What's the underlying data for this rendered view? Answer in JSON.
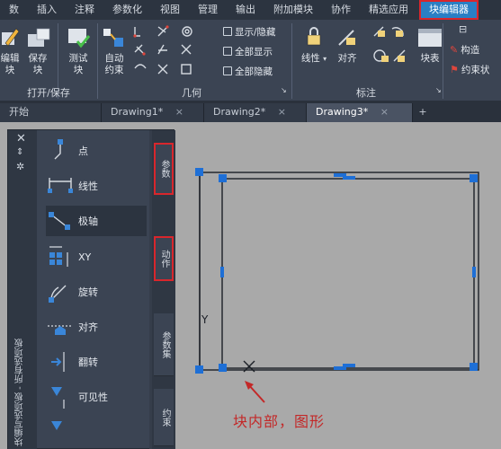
{
  "menubar": {
    "items": [
      "数",
      "插入",
      "注释",
      "参数化",
      "视图",
      "管理",
      "输出",
      "附加模块",
      "协作",
      "精选应用"
    ],
    "active_item": "块编辑器"
  },
  "ribbon": {
    "open_save": {
      "edit_label": "编辑\n块",
      "save_label": "保存\n块",
      "test_label": "测试\n块",
      "group_label": "打开/保存"
    },
    "geometry": {
      "auto_constrain_label": "自动\n约束",
      "show_hide_label": "显示/隐藏",
      "show_all_label": "全部显示",
      "hide_all_label": "全部隐藏",
      "group_label": "几何"
    },
    "dimensional": {
      "linear_label": "线性",
      "align_label": "对齐",
      "group_label": "标注"
    },
    "manage": {
      "block_table_label": "块表",
      "construct_label": "构造",
      "constraint_status_label": "约束状"
    }
  },
  "tabs": {
    "start": "开始",
    "docs": [
      "Drawing1*",
      "Drawing2*",
      "Drawing3*"
    ],
    "active_index": 2
  },
  "palette": {
    "title": "块编写选项板 - 所有选项板",
    "items": [
      "点",
      "线性",
      "极轴",
      "XY",
      "旋转",
      "对齐",
      "翻转",
      "可见性"
    ],
    "selected_index": 2,
    "side_tabs": [
      "参数",
      "动作",
      "参数集",
      "约束"
    ],
    "highlighted_tabs": [
      0,
      1
    ]
  },
  "drawing": {
    "axis_y_label": "Y",
    "annotation": "块内部，图形"
  },
  "colors": {
    "accent": "#2a7fc4",
    "highlight_border": "#d9262c",
    "grip": "#1e6fd6",
    "annotation_red": "#c32828"
  }
}
